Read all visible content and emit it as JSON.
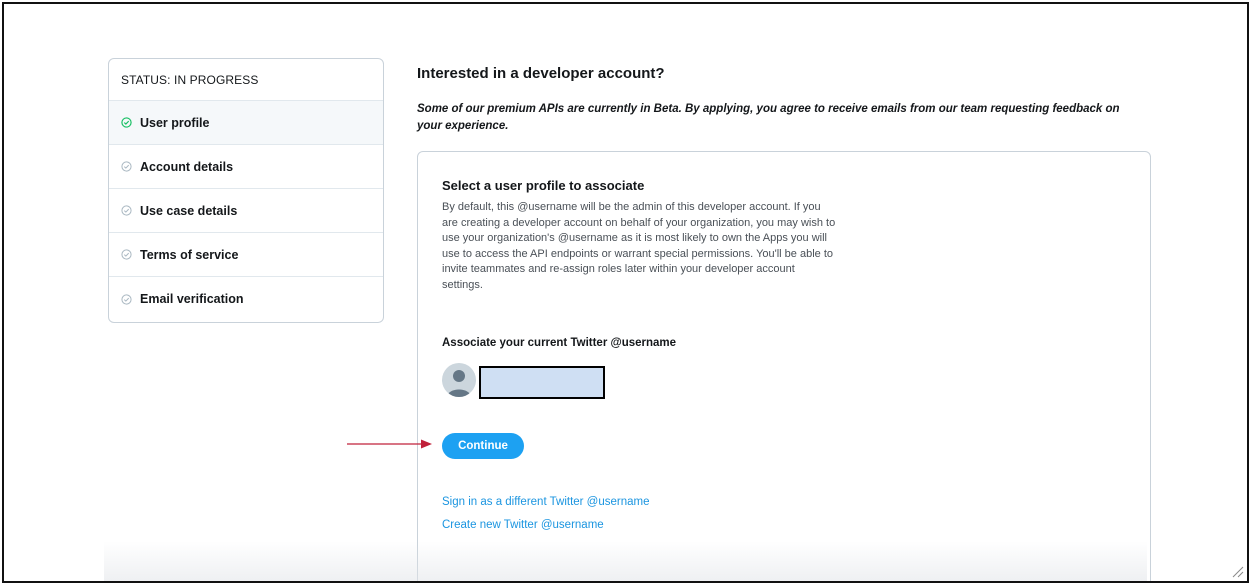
{
  "sidebar": {
    "status": "STATUS: IN PROGRESS",
    "steps": [
      {
        "label": "User profile",
        "active": true
      },
      {
        "label": "Account details",
        "active": false
      },
      {
        "label": "Use case details",
        "active": false
      },
      {
        "label": "Terms of service",
        "active": false
      },
      {
        "label": "Email verification",
        "active": false
      }
    ]
  },
  "main": {
    "heading": "Interested in a developer account?",
    "beta_note": "Some of our premium APIs are currently in Beta. By applying, you agree to receive emails from our team requesting feedback on your experience.",
    "card": {
      "title": "Select a user profile to associate",
      "description": "By default, this @username will be the admin of this developer account. If you are creating a developer account on behalf of your organization, you may wish to use your organization's @username as it is most likely to own the Apps you will use to access the API endpoints or warrant special permissions. You'll be able to invite teammates and re-assign roles later within your developer account settings.",
      "associate_label": "Associate your current Twitter @username",
      "continue_label": "Continue",
      "link_signin": "Sign in as a different Twitter @username",
      "link_create": "Create new Twitter @username"
    }
  },
  "colors": {
    "accent": "#1da1f2",
    "link": "#1b95e0",
    "step_active": "#17bf63",
    "step_inactive": "#aab8c2",
    "arrow": "#c0203a"
  },
  "icons": {
    "step_active": "check-circle-icon",
    "step_inactive": "check-circle-outline-icon",
    "avatar": "default-avatar-icon",
    "annotation": "arrow-right-icon"
  }
}
